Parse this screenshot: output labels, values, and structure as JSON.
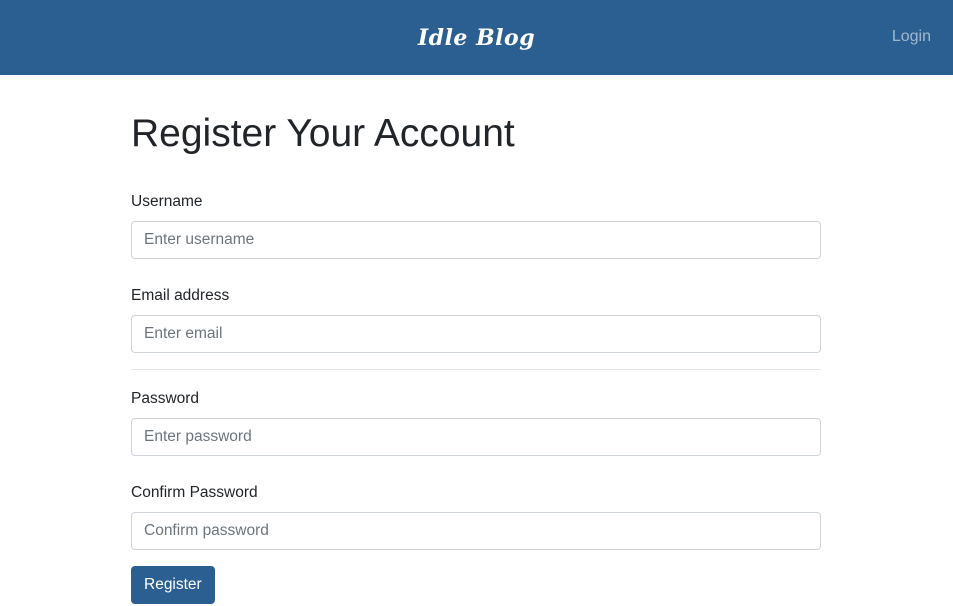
{
  "navbar": {
    "brand": "Idle Blog",
    "login_label": "Login"
  },
  "page": {
    "title": "Register Your Account"
  },
  "form": {
    "username": {
      "label": "Username",
      "placeholder": "Enter username",
      "value": ""
    },
    "email": {
      "label": "Email address",
      "placeholder": "Enter email",
      "value": ""
    },
    "password": {
      "label": "Password",
      "placeholder": "Enter password",
      "value": ""
    },
    "confirm_password": {
      "label": "Confirm Password",
      "placeholder": "Confirm password",
      "value": ""
    },
    "submit_label": "Register"
  },
  "colors": {
    "navbar_bg": "#2c5f91",
    "button_bg": "#2c5f91"
  }
}
